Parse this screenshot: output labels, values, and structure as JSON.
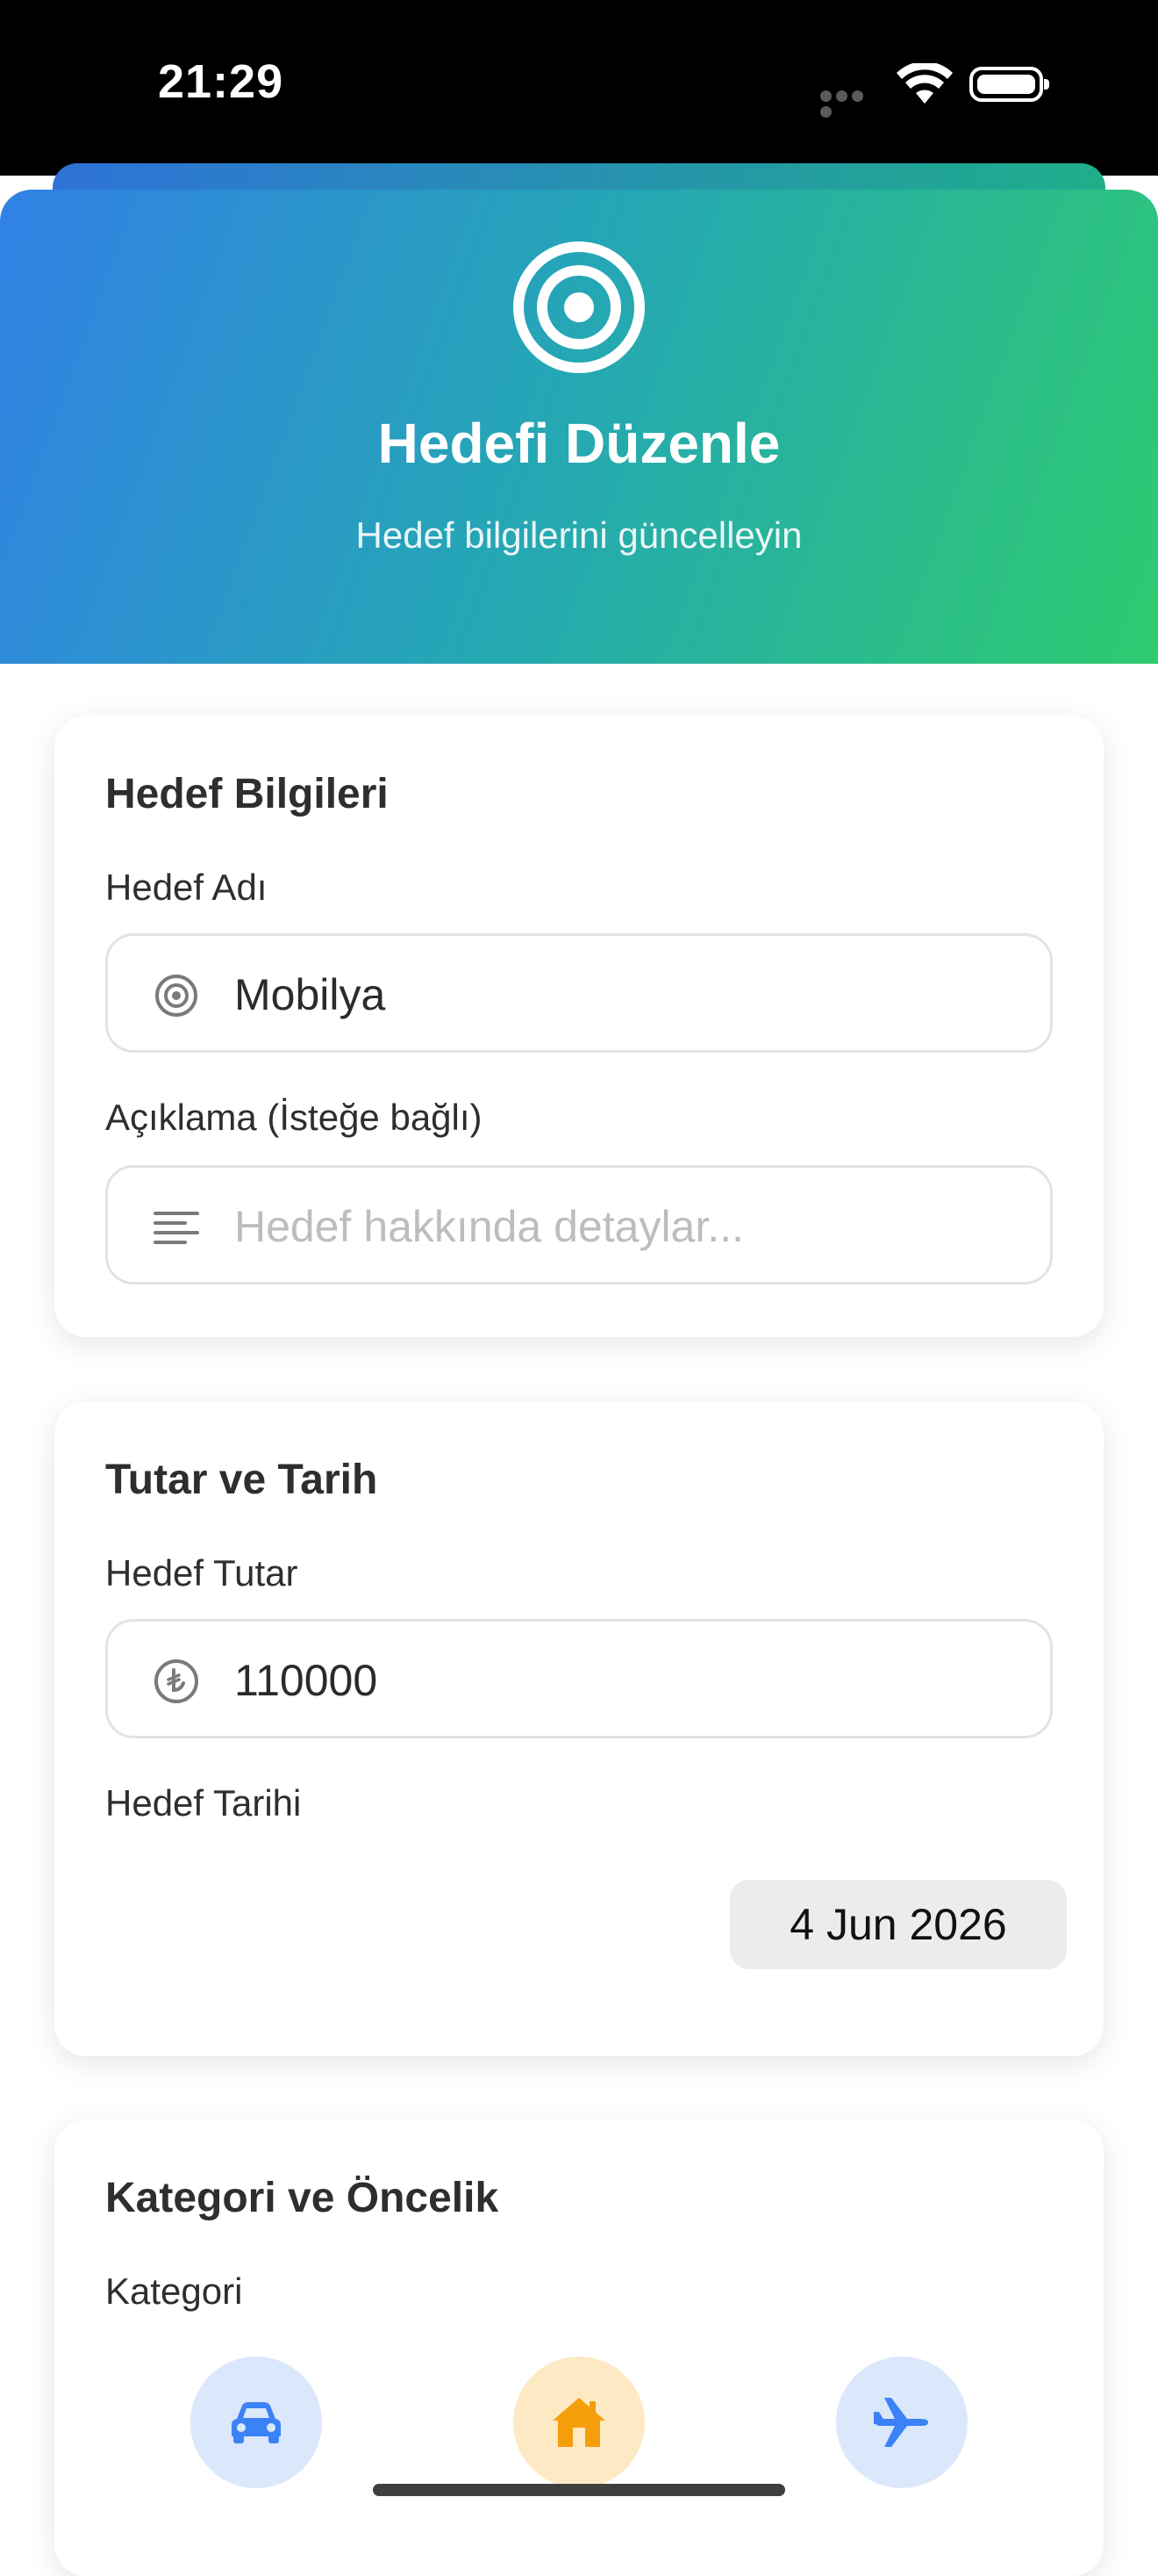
{
  "status_bar": {
    "time": "21:29"
  },
  "header": {
    "title": "Hedefi Düzenle",
    "subtitle": "Hedef bilgilerini güncelleyin",
    "icon": "target-icon",
    "gradient": [
      "#3181e6",
      "#25a7b4",
      "#2ecb6f"
    ]
  },
  "goal_info": {
    "title": "Hedef Bilgileri",
    "name_label": "Hedef Adı",
    "name_value": "Mobilya",
    "description_label": "Açıklama (İsteğe bağlı)",
    "description_placeholder": "Hedef hakkında detaylar...",
    "description_value": ""
  },
  "amount_date": {
    "title": "Tutar ve Tarih",
    "amount_label": "Hedef Tutar",
    "amount_value": "110000",
    "date_label": "Hedef Tarihi",
    "date_value": "4 Jun 2026"
  },
  "category_priority": {
    "title": "Kategori ve Öncelik",
    "category_label": "Kategori",
    "categories": [
      {
        "icon": "car-icon",
        "color": "#3b82f6",
        "background": "#dbe7fb"
      },
      {
        "icon": "house-icon",
        "color": "#f59e0b",
        "background": "#fde9c4",
        "selected": true
      },
      {
        "icon": "airplane-icon",
        "color": "#3b82f6",
        "background": "#dbe7fb"
      }
    ]
  }
}
